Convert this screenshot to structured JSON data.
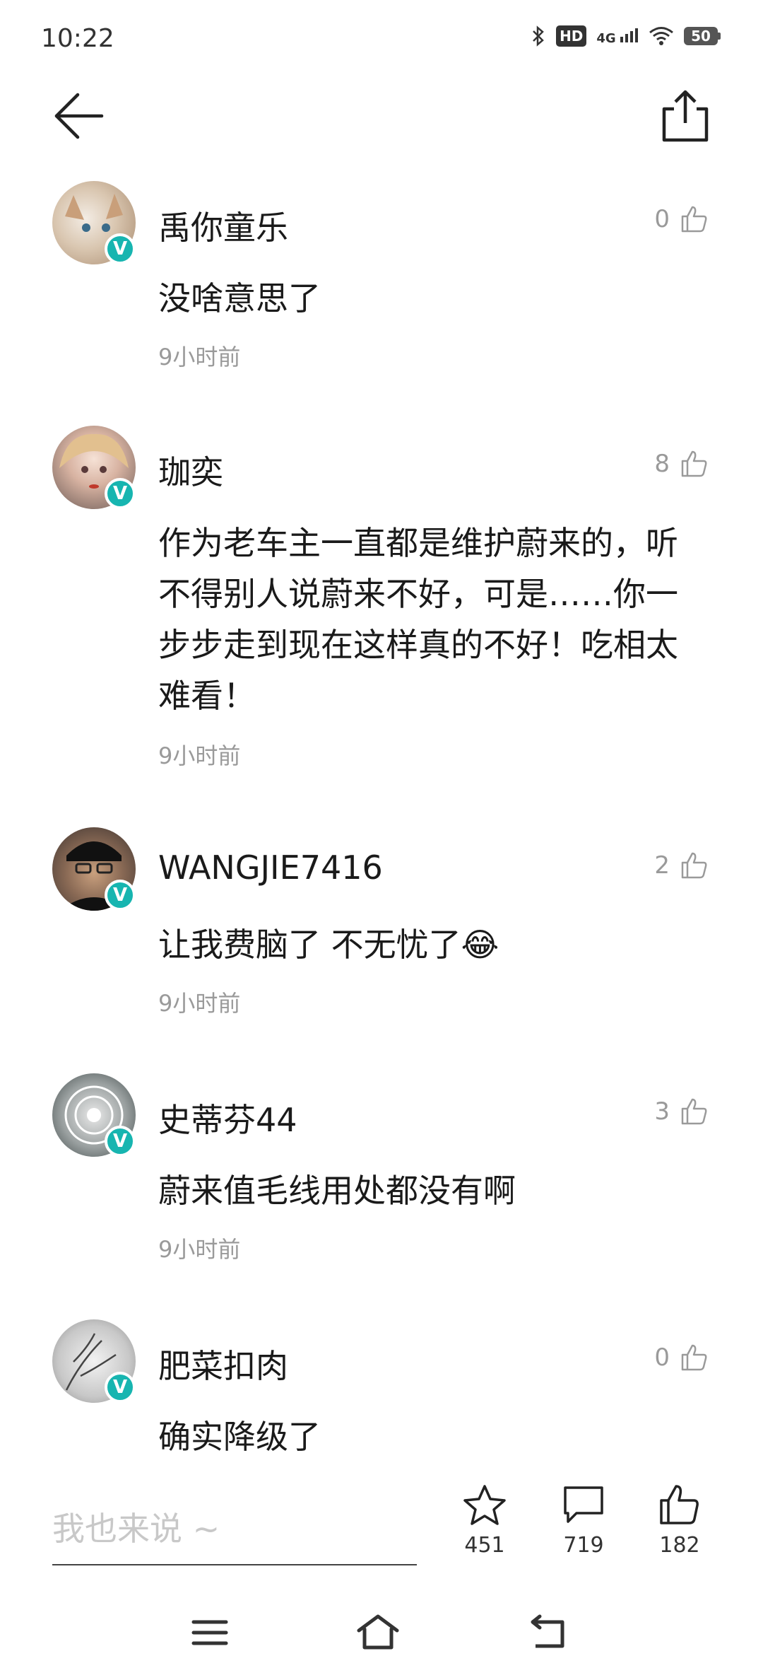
{
  "status_bar": {
    "time": "10:22",
    "hd_label": "HD",
    "network_label": "4G",
    "battery": "50"
  },
  "header": {
    "back_icon": "arrow-left-icon",
    "share_icon": "share-icon"
  },
  "comments": [
    {
      "username": "禹你童乐",
      "likes": "0",
      "text": "没啥意思了",
      "time": "9小时前",
      "verified": "V"
    },
    {
      "username": "珈奕",
      "likes": "8",
      "text": "作为老车主一直都是维护蔚来的，听不得别人说蔚来不好，可是……你一步步走到现在这样真的不好！吃相太难看！",
      "time": "9小时前",
      "verified": "V"
    },
    {
      "username": "WANGJIE7416",
      "likes": "2",
      "text": "让我费脑了 不无忧了😂",
      "time": "9小时前",
      "verified": "V"
    },
    {
      "username": "史蒂芬44",
      "likes": "3",
      "text": "蔚来值毛线用处都没有啊",
      "time": "9小时前",
      "verified": "V"
    },
    {
      "username": "肥菜扣肉",
      "likes": "0",
      "text": "确实降级了",
      "time": "",
      "verified": "V"
    }
  ],
  "action_bar": {
    "input_placeholder": "我也来说 ~",
    "favorite_count": "451",
    "comment_count": "719",
    "like_count": "182"
  },
  "colors": {
    "verified_badge": "#17b5b0",
    "muted_text": "#9a9a9a"
  }
}
